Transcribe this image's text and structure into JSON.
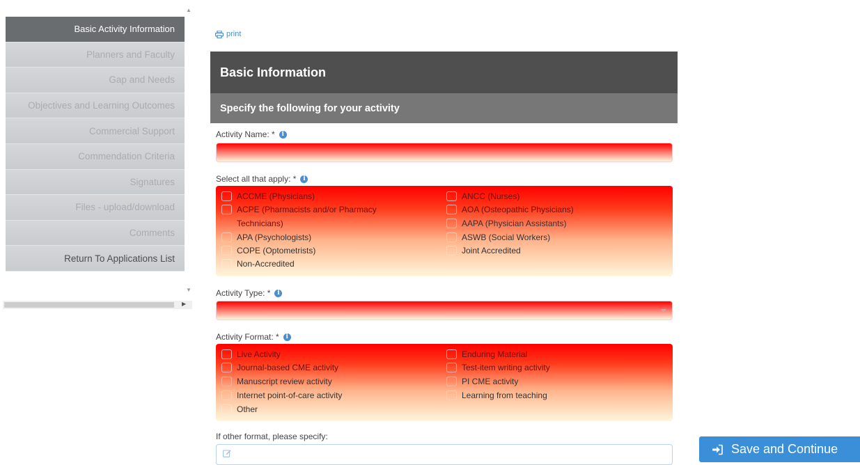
{
  "sidebar": {
    "items": [
      {
        "label": "Basic Activity Information"
      },
      {
        "label": "Planners and Faculty"
      },
      {
        "label": "Gap and Needs"
      },
      {
        "label": "Objectives and Learning Outcomes"
      },
      {
        "label": "Commercial Support"
      },
      {
        "label": "Commendation Criteria"
      },
      {
        "label": "Signatures"
      },
      {
        "label": "Files - upload/download"
      },
      {
        "label": "Comments"
      },
      {
        "label": "Return To Applications List"
      }
    ]
  },
  "print_label": "print",
  "panel": {
    "title": "Basic Information",
    "subtitle": "Specify the following for your activity"
  },
  "fields": {
    "activity_name": {
      "label": "Activity Name: *",
      "value": ""
    },
    "select_all": {
      "label": "Select all that apply: *",
      "left": [
        "ACCME (Physicians)",
        "ACPE (Pharmacists and/or Pharmacy",
        "Technicians)",
        "APA (Psychologists)",
        "COPE (Optometrists)",
        "Non-Accredited"
      ],
      "right": [
        "ANCC (Nurses)",
        "AOA (Osteopathic Physicians)",
        "AAPA (Physician Assistants)",
        "ASWB (Social Workers)",
        "Joint Accredited"
      ]
    },
    "activity_type": {
      "label": "Activity Type: *",
      "value": ""
    },
    "activity_format": {
      "label": "Activity Format: *",
      "left": [
        "Live Activity",
        "Journal-based CME activity",
        "Manuscript review activity",
        "Internet point-of-care activity",
        "Other"
      ],
      "right": [
        "Enduring Material",
        "Test-item writing activity",
        "PI CME activity",
        "Learning from teaching"
      ]
    },
    "other_format": {
      "label": "If other format, please specify:",
      "value": ""
    }
  },
  "save_button": "Save and Continue",
  "colors": {
    "accent": "#3a8fd8",
    "error": "#ff0000",
    "header": "#4f4f4f",
    "subheader": "#777777"
  }
}
